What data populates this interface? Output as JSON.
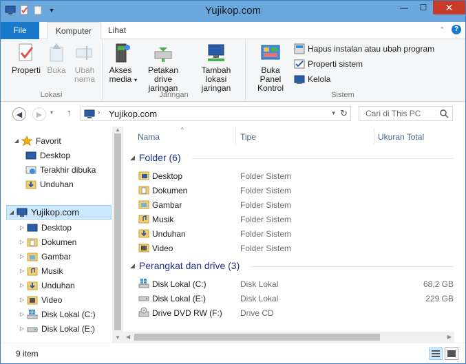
{
  "window": {
    "title": "Yujikop.com",
    "minimize": "—",
    "maximize": "☐",
    "close": "✕"
  },
  "tabs": {
    "file": "File",
    "komputer": "Komputer",
    "lihat": "Lihat"
  },
  "ribbon": {
    "lokasi": {
      "label": "Lokasi",
      "properti": "Properti",
      "buka": "Buka",
      "ubah_nama": "Ubah nama"
    },
    "jaringan": {
      "label": "Jaringan",
      "akses_media": "Akses media",
      "petakan": "Petakan drive jaringan",
      "tambah": "Tambah lokasi jaringan"
    },
    "sistem": {
      "label": "Sistem",
      "buka_panel": "Buka Panel Kontrol",
      "hapus": "Hapus instalan atau ubah program",
      "properti_sistem": "Properti sistem",
      "kelola": "Kelola"
    }
  },
  "address": {
    "path": "Yujikop.com",
    "search_placeholder": "Cari di This PC"
  },
  "nav": {
    "favorit": "Favorit",
    "fav_items": [
      "Desktop",
      "Terakhir dibuka",
      "Unduhan"
    ],
    "pc": "Yujikop.com",
    "pc_items": [
      "Desktop",
      "Dokumen",
      "Gambar",
      "Musik",
      "Unduhan",
      "Video",
      "Disk Lokal (C:)",
      "Disk Lokal (E:)"
    ]
  },
  "columns": {
    "name": "Nama",
    "type": "Tipe",
    "size": "Ukuran Total"
  },
  "groups": {
    "folder": "Folder (6)",
    "drives": "Perangkat dan drive (3)"
  },
  "folders": [
    {
      "name": "Desktop",
      "type": "Folder Sistem"
    },
    {
      "name": "Dokumen",
      "type": "Folder Sistem"
    },
    {
      "name": "Gambar",
      "type": "Folder Sistem"
    },
    {
      "name": "Musik",
      "type": "Folder Sistem"
    },
    {
      "name": "Unduhan",
      "type": "Folder Sistem"
    },
    {
      "name": "Video",
      "type": "Folder Sistem"
    }
  ],
  "drives": [
    {
      "name": "Disk Lokal (C:)",
      "type": "Disk Lokal",
      "size": "68,2 GB"
    },
    {
      "name": "Disk Lokal (E:)",
      "type": "Disk Lokal",
      "size": "229 GB"
    },
    {
      "name": "Drive DVD RW (F:)",
      "type": "Drive CD",
      "size": ""
    }
  ],
  "status": {
    "count": "9 item"
  }
}
